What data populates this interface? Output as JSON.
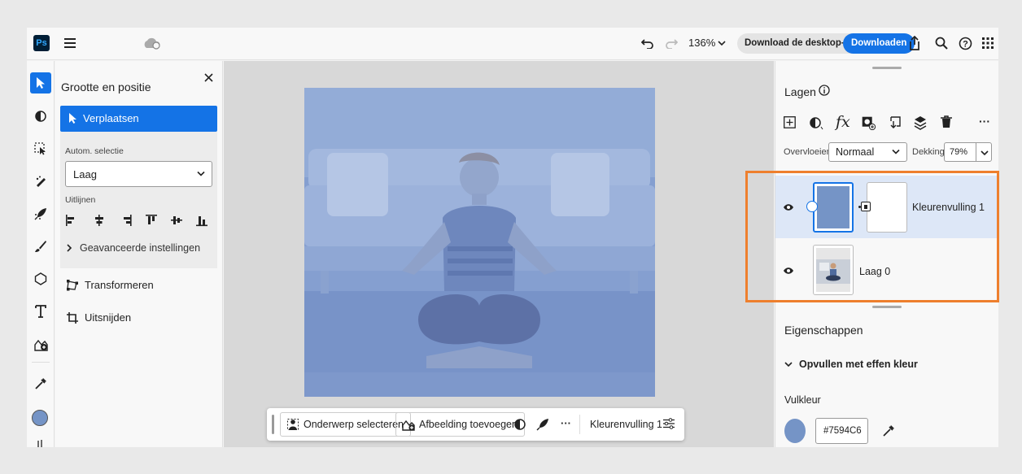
{
  "app": {
    "logo": "Ps"
  },
  "topbar": {
    "zoom": "136%",
    "download_app": "Download de desktop-app",
    "download": "Downloaden",
    "icons": [
      "menu-icon",
      "cloud-sync-icon",
      "undo-icon",
      "redo-icon",
      "share-icon",
      "search-icon",
      "help-icon",
      "apps-grid-icon"
    ]
  },
  "options": {
    "title": "Grootte en positie",
    "move": "Verplaatsen",
    "auto_select_label": "Autom. selectie",
    "auto_select_value": "Laag",
    "align_label": "Uitlijnen",
    "advanced": "Geavanceerde instellingen",
    "transform": "Transformeren",
    "crop": "Uitsnijden"
  },
  "taskbar": {
    "select_subject": "Onderwerp selecteren",
    "add_image": "Afbeelding toevoegen",
    "more": "···",
    "layer_name": "Kleurenvulling 1"
  },
  "layers": {
    "title": "Lagen",
    "blend_label": "Overvloeien",
    "blend_value": "Normaal",
    "opacity_label": "Dekking",
    "opacity_value": "79%",
    "more": "···",
    "items": [
      {
        "name": "Kleurenvulling 1"
      },
      {
        "name": "Laag 0"
      }
    ]
  },
  "properties": {
    "title": "Eigenschappen",
    "section": "Opvullen met effen kleur",
    "fill_label": "Vulkleur",
    "fill_hex": "#7594C6"
  },
  "colors": {
    "accent": "#1473e6",
    "fill": "#7594C6",
    "highlight": "#ee7f2d"
  }
}
